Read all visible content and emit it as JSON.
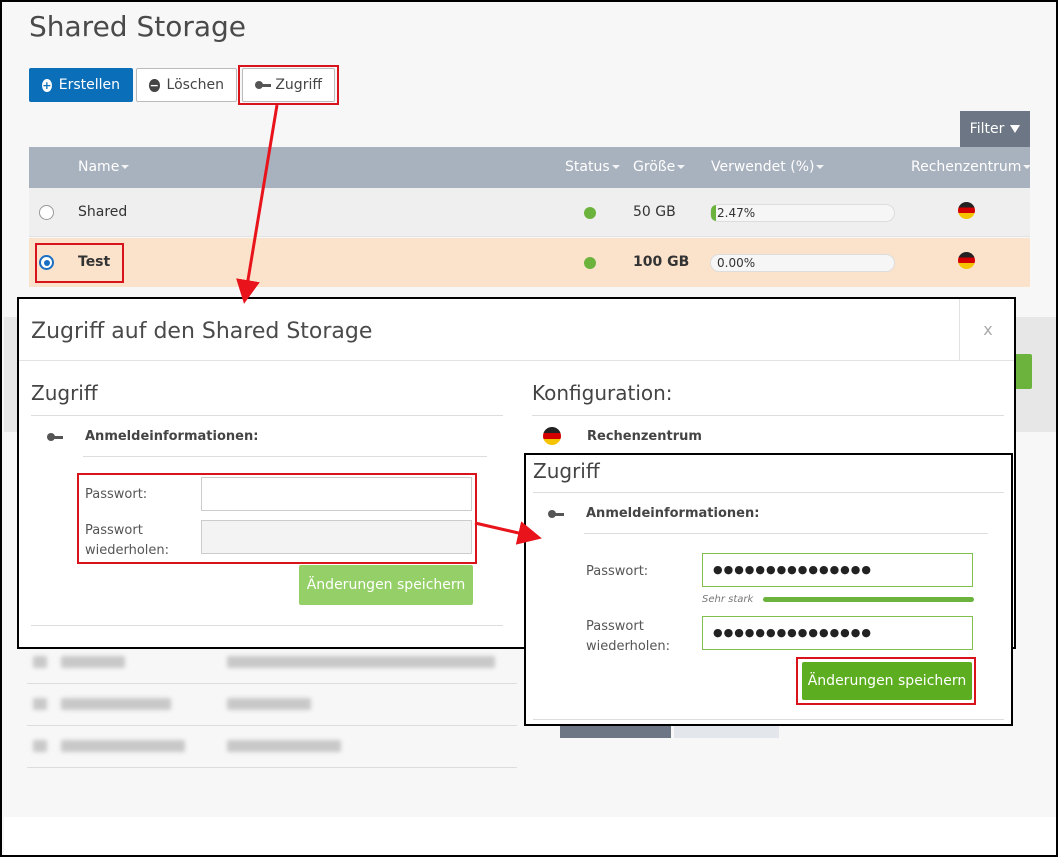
{
  "page": {
    "title": "Shared Storage"
  },
  "toolbar": {
    "create_label": "Erstellen",
    "delete_label": "Löschen",
    "access_label": "Zugriff",
    "filter_label": "Filter"
  },
  "table": {
    "columns": {
      "name": "Name",
      "status": "Status",
      "size": "Größe",
      "used": "Verwendet (%)",
      "datacenter": "Rechenzentrum"
    },
    "rows": [
      {
        "name": "Shared",
        "status": "online",
        "size": "50 GB",
        "used_label": "2.47%",
        "used_fraction": 0.0247,
        "selected": false,
        "flag": "germany-flag"
      },
      {
        "name": "Test",
        "status": "online",
        "size": "100 GB",
        "used_label": "0.00%",
        "used_fraction": 0.0,
        "selected": true,
        "flag": "germany-flag"
      }
    ]
  },
  "modal": {
    "title": "Zugriff auf den Shared Storage",
    "close_label": "x",
    "left": {
      "section_title": "Zugriff",
      "credentials_label": "Anmeldeinformationen:",
      "password_label": "Passwort:",
      "password_value": "",
      "repeat_label": "Passwort wiederholen:",
      "repeat_value": "",
      "save_label": "Änderungen speichern"
    },
    "right": {
      "section_title": "Konfiguration:",
      "datacenter_label": "Rechenzentrum"
    }
  },
  "panel": {
    "section_title": "Zugriff",
    "credentials_label": "Anmeldeinformationen:",
    "password_label": "Passwort:",
    "password_value": "●●●●●●●●●●●●●●●",
    "strength_label": "Sehr stark",
    "strength_fraction": 1.0,
    "repeat_label": "Passwort wiederholen:",
    "repeat_value": "●●●●●●●●●●●●●●●",
    "save_label": "Änderungen speichern"
  },
  "colors": {
    "primary": "#0a6fb8",
    "highlight": "#d9131b",
    "success": "#6cb33e",
    "selected_row": "#fbe3cb",
    "table_header": "#a8b1be"
  },
  "icons": [
    "plus-circle-icon",
    "minus-circle-icon",
    "key-icon",
    "filter-icon",
    "sort-caret-icon",
    "germany-flag-icon",
    "status-dot-icon"
  ]
}
